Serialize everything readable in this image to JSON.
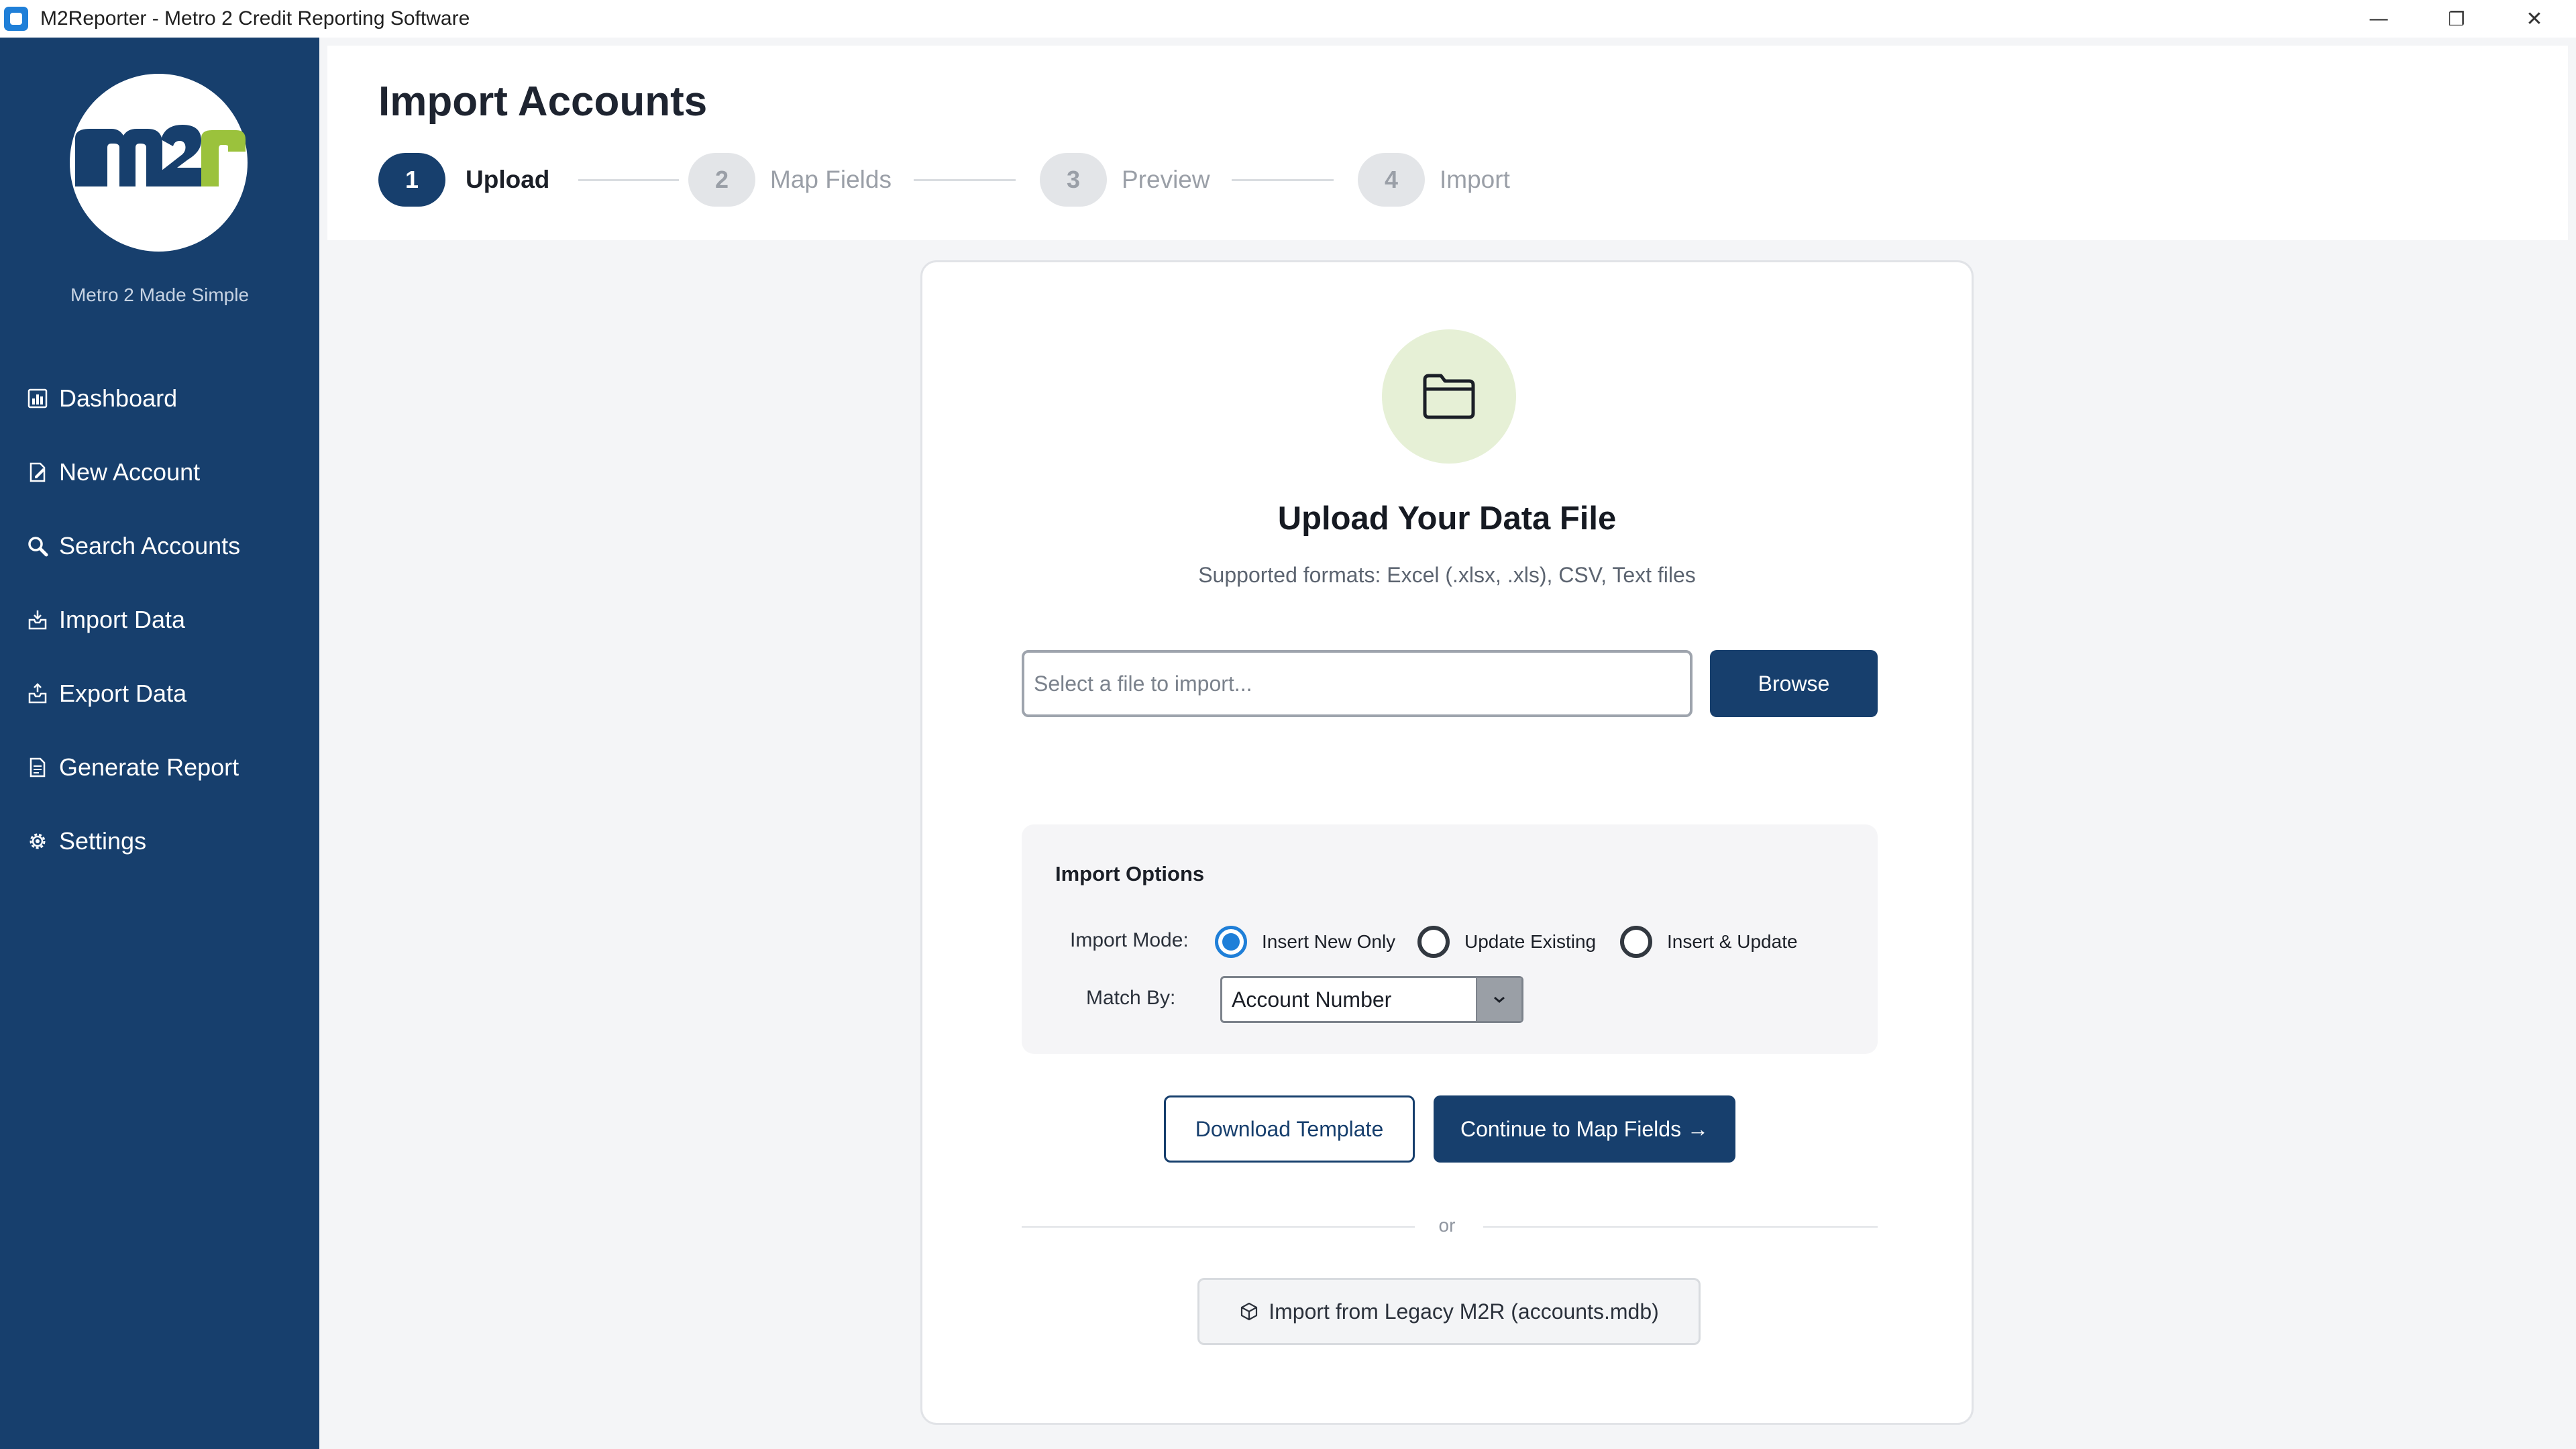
{
  "window": {
    "title": "M2Reporter - Metro 2 Credit Reporting Software",
    "controls": {
      "minimize": "—",
      "maximize": "❐",
      "close": "✕"
    }
  },
  "sidebar": {
    "logo_text": "m2r",
    "tagline": "Metro 2 Made Simple",
    "items": [
      {
        "label": "Dashboard",
        "icon": "bar-chart-icon"
      },
      {
        "label": "New Account",
        "icon": "edit-document-icon"
      },
      {
        "label": "Search Accounts",
        "icon": "magnifier-icon"
      },
      {
        "label": "Import Data",
        "icon": "inbox-tray-icon"
      },
      {
        "label": "Export Data",
        "icon": "outbox-tray-icon"
      },
      {
        "label": "Generate Report",
        "icon": "document-icon"
      },
      {
        "label": "Settings",
        "icon": "gear-icon"
      }
    ]
  },
  "header": {
    "title": "Import Accounts",
    "steps": [
      {
        "number": "1",
        "label": "Upload",
        "state": "active"
      },
      {
        "number": "2",
        "label": "Map Fields",
        "state": "inactive"
      },
      {
        "number": "3",
        "label": "Preview",
        "state": "inactive"
      },
      {
        "number": "4",
        "label": "Import",
        "state": "inactive"
      }
    ]
  },
  "upload": {
    "heading": "Upload Your Data File",
    "formats": "Supported formats: Excel (.xlsx, .xls), CSV, Text files",
    "file_placeholder": "Select a file to import...",
    "file_value": "",
    "browse_label": "Browse"
  },
  "options": {
    "title": "Import Options",
    "mode_label": "Import Mode:",
    "modes": [
      {
        "label": "Insert New Only",
        "checked": true
      },
      {
        "label": "Update Existing",
        "checked": false
      },
      {
        "label": "Insert & Update",
        "checked": false
      }
    ],
    "match_label": "Match By:",
    "match_value": "Account Number"
  },
  "actions": {
    "download_template": "Download Template",
    "continue": "Continue to Map Fields →",
    "or": "or",
    "legacy_import": "Import from Legacy M2R (accounts.mdb)"
  },
  "colors": {
    "sidebar": "#173f6d",
    "primary": "#173f6d",
    "radio_accent": "#1f7fd8",
    "logo_green": "#9bc23c",
    "folder_bg": "#e6f0d6"
  }
}
